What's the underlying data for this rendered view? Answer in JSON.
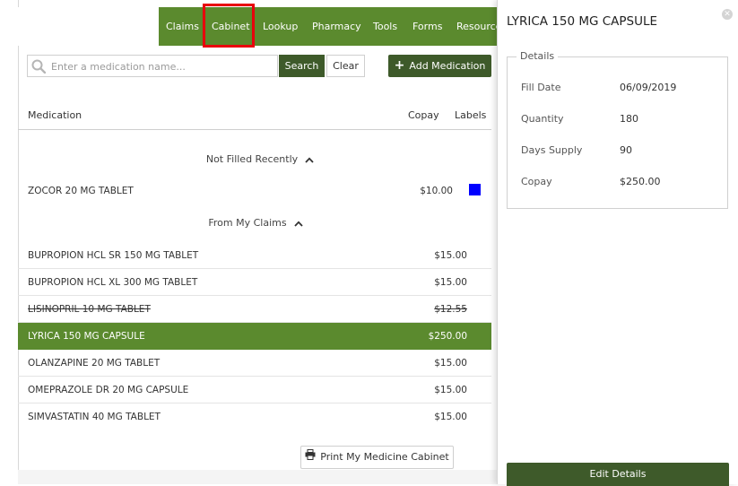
{
  "nav": {
    "items": [
      "Claims",
      "Cabinet",
      "Lookup",
      "Pharmacy",
      "Tools",
      "Forms",
      "Resource"
    ],
    "active": "Cabinet"
  },
  "search": {
    "placeholder": "Enter a medication name...",
    "value": "",
    "search_label": "Search",
    "clear_label": "Clear",
    "add_label": "Add Medication"
  },
  "table": {
    "headers": {
      "medication": "Medication",
      "copay": "Copay",
      "labels": "Labels"
    },
    "sections": [
      {
        "title": "Not Filled Recently",
        "rows": [
          {
            "name": "ZOCOR 20 MG TABLET",
            "copay": "$10.00",
            "label_color": "#0000ff"
          }
        ]
      },
      {
        "title": "From My Claims",
        "rows": [
          {
            "name": "BUPROPION HCL SR 150 MG TABLET",
            "copay": "$15.00"
          },
          {
            "name": "BUPROPION HCL XL 300 MG TABLET",
            "copay": "$15.00"
          },
          {
            "name": "LISINOPRIL 10 MG TABLET",
            "copay": "$12.55",
            "struck": true
          },
          {
            "name": "LYRICA 150 MG CAPSULE",
            "copay": "$250.00",
            "selected": true
          },
          {
            "name": "OLANZAPINE 20 MG TABLET",
            "copay": "$15.00"
          },
          {
            "name": "OMEPRAZOLE DR 20 MG CAPSULE",
            "copay": "$15.00"
          },
          {
            "name": "SIMVASTATIN 40 MG TABLET",
            "copay": "$15.00"
          }
        ]
      }
    ],
    "print_label": "Print My Medicine Cabinet"
  },
  "detail": {
    "title": "LYRICA 150 MG CAPSULE",
    "legend": "Details",
    "fields": [
      {
        "label": "Fill Date",
        "value": "06/09/2019"
      },
      {
        "label": "Quantity",
        "value": "180"
      },
      {
        "label": "Days Supply",
        "value": "90"
      },
      {
        "label": "Copay",
        "value": "$250.00"
      }
    ],
    "edit_label": "Edit Details"
  },
  "colors": {
    "nav_green": "#5b8a2e",
    "button_dark_green": "#3e5a2a",
    "highlight_red": "#e8000b"
  }
}
